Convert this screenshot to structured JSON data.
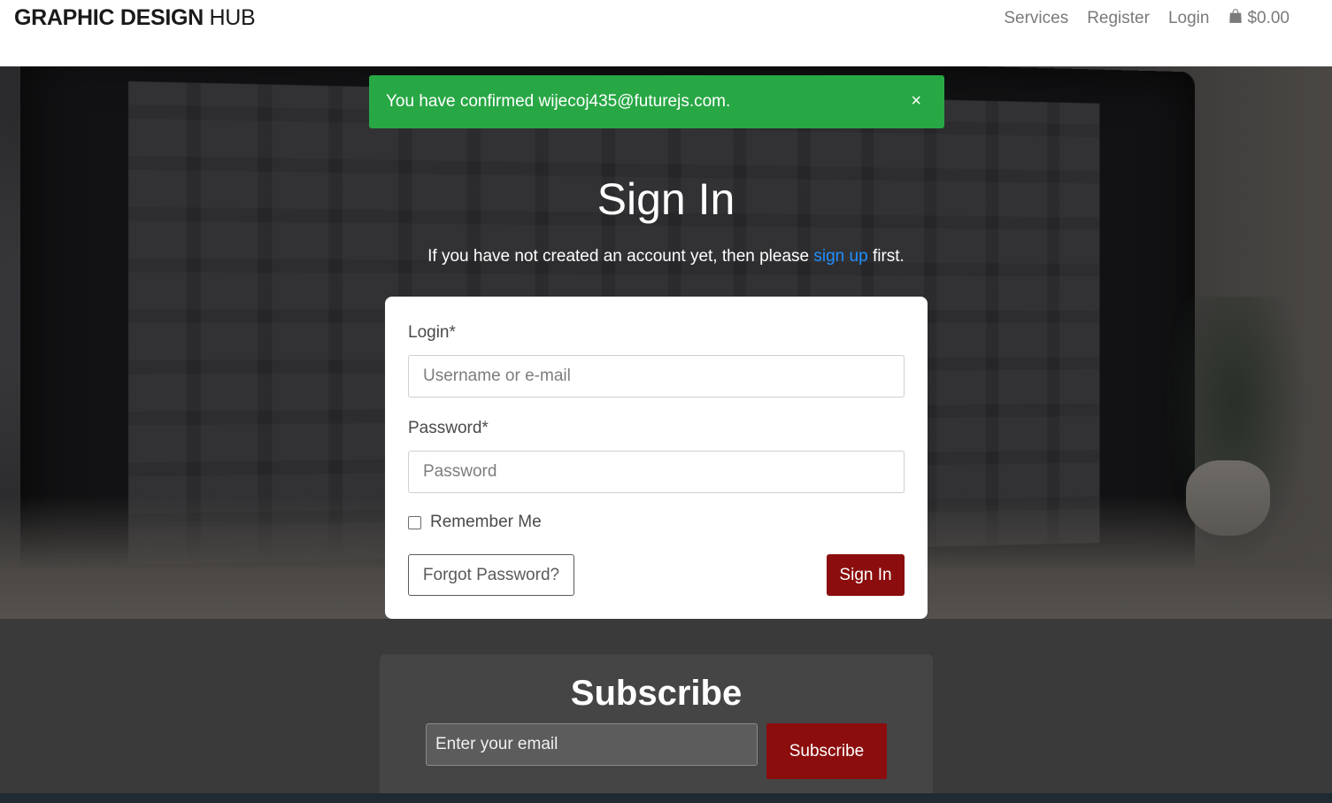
{
  "navbar": {
    "brand_bold": "GRAPHIC DESIGN",
    "brand_light": "HUB",
    "links": {
      "services": "Services",
      "register": "Register",
      "login": "Login"
    },
    "cart_total": "$0.00",
    "cart_icon": "shopping-bag-icon"
  },
  "alert": {
    "message": "You have confirmed wijecoj435@futurejs.com.",
    "close": "×",
    "color": "#28a745"
  },
  "signin": {
    "title": "Sign In",
    "subtitle_pre": "If you have not created an account yet, then please ",
    "subtitle_link": "sign up",
    "subtitle_post": " first.",
    "login_label": "Login*",
    "login_placeholder": "Username or e-mail",
    "password_label": "Password*",
    "password_placeholder": "Password",
    "remember_label": "Remember Me",
    "forgot_label": "Forgot Password?",
    "submit_label": "Sign In",
    "accent": "#8b0d0d"
  },
  "subscribe": {
    "title": "Subscribe",
    "placeholder": "Enter your email",
    "button_label": "Subscribe"
  }
}
